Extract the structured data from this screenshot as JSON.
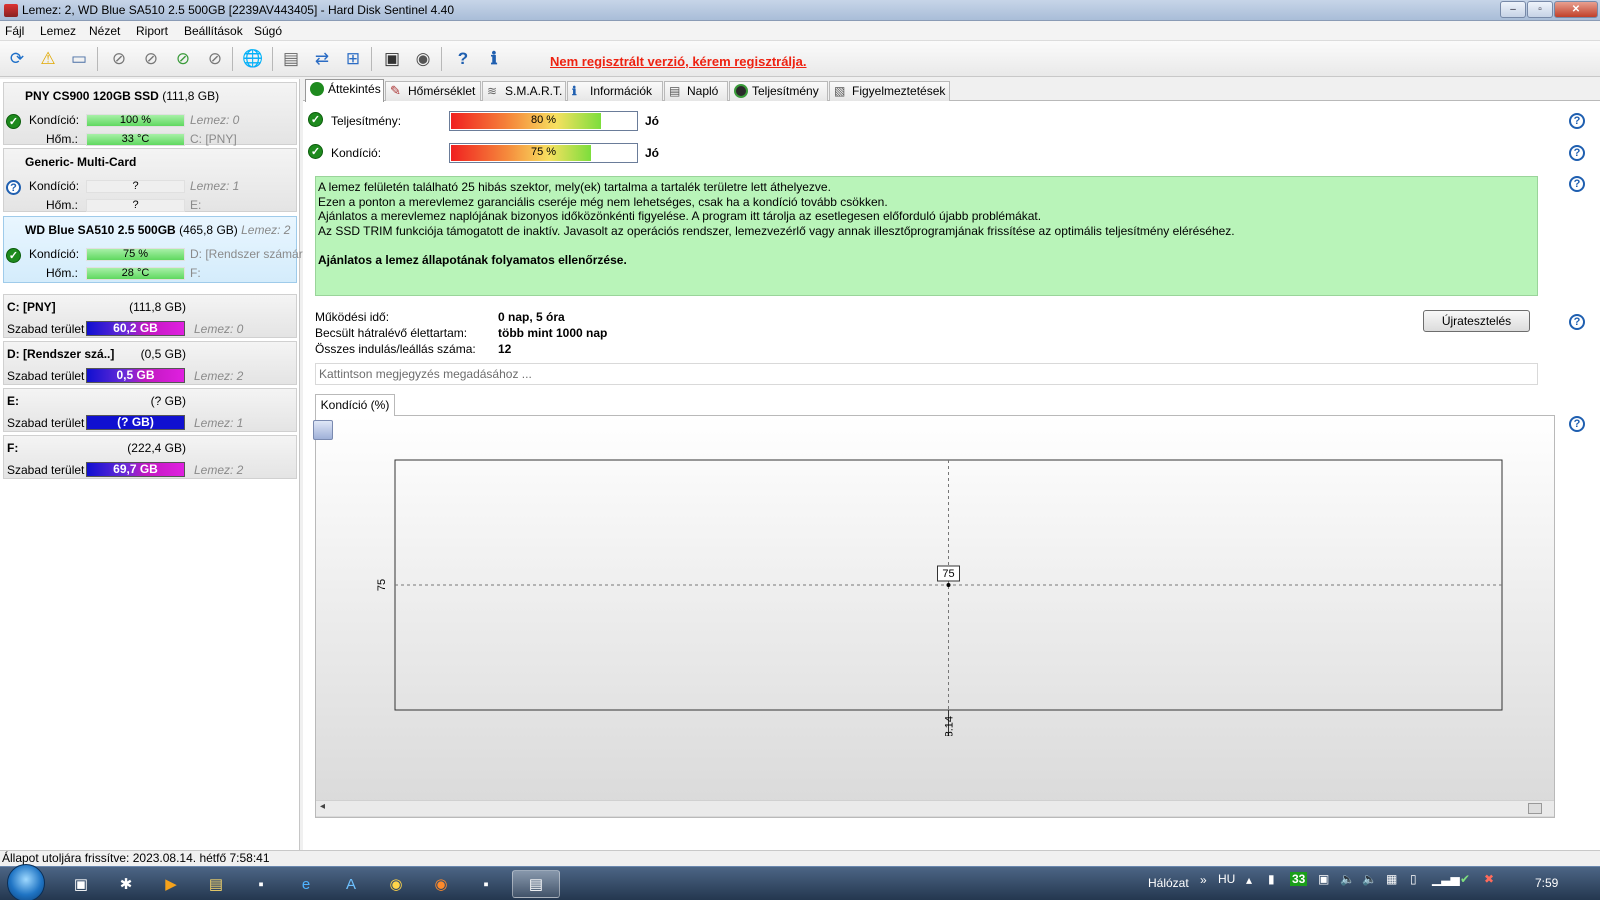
{
  "window": {
    "title": "Lemez: 2, WD Blue SA510 2.5 500GB [2239AV443405] - Hard Disk Sentinel 4.40",
    "controls": [
      "–",
      "▫",
      "✕"
    ]
  },
  "menu": [
    "Fájl",
    "Lemez",
    "Nézet",
    "Riport",
    "Beállítások",
    "Súgó"
  ],
  "toolbar": {
    "register_msg": "Nem regisztrált verzió, kérem regisztrálja."
  },
  "disks": [
    {
      "name": "PNY CS900 120GB SSD",
      "size": "(111,8 GB)",
      "cond_label": "Kondíció:",
      "cond": "100 %",
      "cond_fill": 1.0,
      "temp_label": "Hőm.:",
      "temp": "33 °C",
      "temp_fill": 1.0,
      "disk_no": "Lemez: 0",
      "drive": "C: [PNY]",
      "status": "ok"
    },
    {
      "name": "Generic- Multi-Card",
      "size": "",
      "cond_label": "Kondíció:",
      "cond": "?",
      "cond_fill": 0,
      "temp_label": "Hőm.:",
      "temp": "?",
      "temp_fill": 0,
      "disk_no": "Lemez: 1",
      "drive": "E:",
      "status": "unknown"
    },
    {
      "name": "WD Blue SA510 2.5 500GB",
      "size": "(465,8 GB)",
      "size_extra": "Lemez: 2",
      "cond_label": "Kondíció:",
      "cond": "75 %",
      "cond_fill": 1.0,
      "temp_label": "Hőm.:",
      "temp": "28 °C",
      "temp_fill": 1.0,
      "disk_no": "D: [Rendszer számár",
      "drive": "F:",
      "status": "ok"
    }
  ],
  "volumes": [
    {
      "name": "C: [PNY]",
      "size": "(111,8 GB)",
      "free_label": "Szabad terület",
      "free": "60,2 GB",
      "disk": "Lemez: 0"
    },
    {
      "name": "D: [Rendszer szá..]",
      "size": "(0,5 GB)",
      "free_label": "Szabad terület",
      "free": "0,5 GB",
      "disk": "Lemez: 2"
    },
    {
      "name": "E:",
      "size": "(? GB)",
      "free_label": "Szabad terület",
      "free": "(? GB)",
      "disk": "Lemez: 1"
    },
    {
      "name": "F:",
      "size": "(222,4 GB)",
      "free_label": "Szabad terület",
      "free": "69,7 GB",
      "disk": "Lemez: 2"
    }
  ],
  "tabs": [
    "Áttekintés",
    "Hőmérséklet",
    "S.M.A.R.T.",
    "Információk",
    "Napló",
    "Teljesítmény",
    "Figyelmeztetések"
  ],
  "overview": {
    "performance_label": "Teljesítmény:",
    "performance_value": "80 %",
    "performance_fraction": 0.8,
    "performance_status": "Jó",
    "condition_label": "Kondíció:",
    "condition_value": "75 %",
    "condition_fraction": 0.75,
    "condition_status": "Jó",
    "messages": [
      "A lemez felületén található 25 hibás szektor, mely(ek) tartalma a tartalék területre lett áthelyezve.",
      "Ezen a ponton a merevlemez garanciális cseréje még nem lehetséges, csak ha a kondíció tovább csökken.",
      "Ajánlatos a merevlemez naplójának bizonyos időközönkénti figyelése. A program itt tárolja az esetlegesen előforduló újabb problémákat.",
      "Az SSD TRIM funkciója támogatott de inaktív. Javasolt az operációs rendszer, lemezvezérlő vagy annak illesztőprogramjának frissítése az optimális teljesítmény eléréséhez."
    ],
    "recommendation": "Ajánlatos a lemez állapotának folyamatos ellenőrzése.",
    "uptime_label": "Működési idő:",
    "uptime": "0 nap, 5 óra",
    "lifetime_label": "Becsült hátralévő élettartam:",
    "lifetime": "több mint 1000 nap",
    "startstop_label": "Összes indulás/leállás száma:",
    "startstop": "12",
    "retest_button": "Újratesztelés",
    "notes_placeholder": "Kattintson megjegyzés megadásához ..."
  },
  "chart_tab": "Kondíció  (%)",
  "chart_data": {
    "type": "line",
    "x": [
      "2023.08.14"
    ],
    "series": [
      {
        "values": [
          75
        ]
      }
    ],
    "ylabel": "",
    "xlabel": "",
    "y_ticks": [
      "75"
    ],
    "point_labels": [
      "75"
    ],
    "grid": true
  },
  "statusbar": {
    "text": "Állapot utoljára frissítve: 2023.08.14. hétfő 7:58:41"
  },
  "taskbar": {
    "network": "Hálózat",
    "lang": "HU",
    "tray_badge": "33",
    "clock": "7:59"
  }
}
